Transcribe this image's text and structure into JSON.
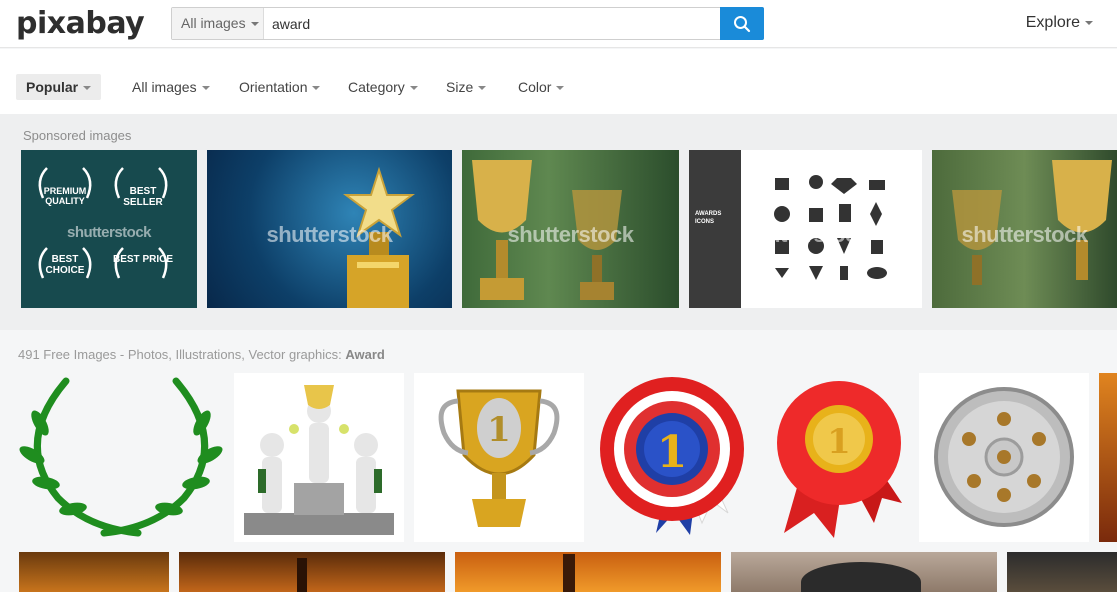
{
  "header": {
    "logo": "pixabay",
    "search_filter": "All images",
    "search_value": "award",
    "explore": "Explore"
  },
  "filters": {
    "popular": "Popular",
    "all_images": "All images",
    "orientation": "Orientation",
    "category": "Category",
    "size": "Size",
    "color": "Color"
  },
  "sponsored": {
    "label": "Sponsored images",
    "watermark": "shutterstock",
    "badges": [
      "PREMIUM QUALITY",
      "BEST SELLER",
      "BEST CHOICE",
      "BEST PRICE"
    ],
    "icons_panel_title": "AWARDS ICONS"
  },
  "results": {
    "count_text": "491 Free Images - Photos, Illustrations, Vector graphics:",
    "query": "Award"
  },
  "colors": {
    "accent": "#1a8bd9",
    "laurel_green": "#1f8d1f",
    "gold": "#d9a520",
    "ribbon_red": "#e02020",
    "ribbon_blue": "#1f3fa6"
  }
}
